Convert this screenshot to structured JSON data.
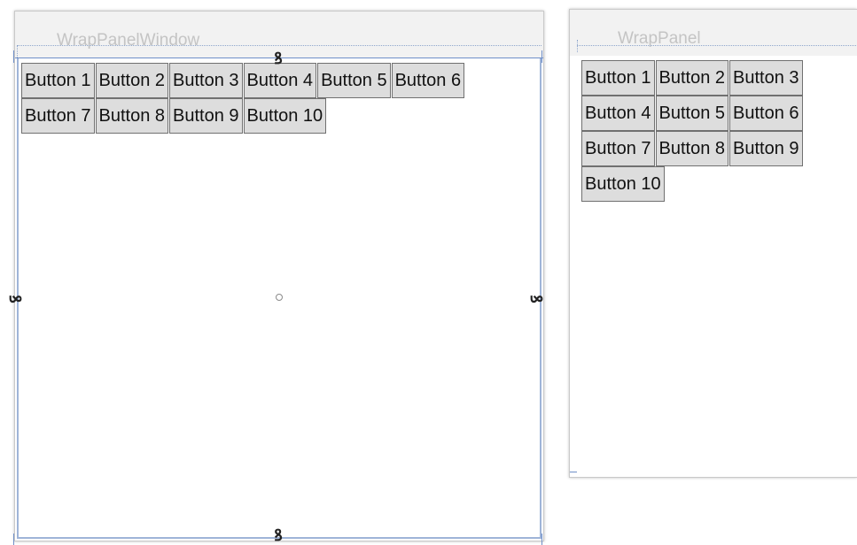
{
  "left_window": {
    "title": "WrapPanelWindow",
    "buttons": [
      "Button 1",
      "Button 2",
      "Button 3",
      "Button 4",
      "Button 5",
      "Button 6",
      "Button 7",
      "Button 8",
      "Button 9",
      "Button 10"
    ]
  },
  "right_window": {
    "title": "WrapPanel",
    "buttons": [
      "Button 1",
      "Button 2",
      "Button 3",
      "Button 4",
      "Button 5",
      "Button 6",
      "Button 7",
      "Button 8",
      "Button 9",
      "Button 10"
    ]
  },
  "adorner": {
    "anchor_glyph": "ꝸ"
  },
  "colors": {
    "guide_blue": "#6f8fc8",
    "button_bg": "#dddddd",
    "button_border": "#707070",
    "title_text": "#c4c4c4"
  }
}
